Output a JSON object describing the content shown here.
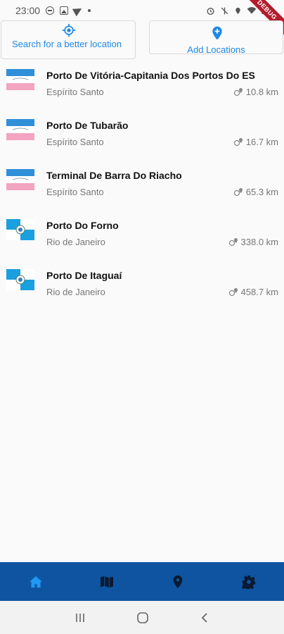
{
  "status_bar": {
    "time": "23:00"
  },
  "debug_banner": "DEBUG",
  "top_buttons": {
    "search_label": "Search for a better location",
    "add_label": "Add Locations"
  },
  "colors": {
    "accent": "#1e88e5",
    "nav_bar": "#0e54a0",
    "nav_active": "#2196f3",
    "nav_inactive": "#0a1a30"
  },
  "locations": [
    {
      "name": "Porto De Vitória-Capitania Dos Portos Do ES",
      "state": "Espírito Santo",
      "distance": "10.8 km",
      "flag": "espirito-santo-flag"
    },
    {
      "name": "Porto De Tubarão",
      "state": "Espírito Santo",
      "distance": "16.7 km",
      "flag": "espirito-santo-flag"
    },
    {
      "name": "Terminal De Barra Do Riacho",
      "state": "Espírito Santo",
      "distance": "65.3 km",
      "flag": "espirito-santo-flag"
    },
    {
      "name": "Porto Do Forno",
      "state": "Rio de Janeiro",
      "distance": "338.0 km",
      "flag": "rio-de-janeiro-flag"
    },
    {
      "name": "Porto De Itaguaí",
      "state": "Rio de Janeiro",
      "distance": "458.7 km",
      "flag": "rio-de-janeiro-flag"
    }
  ],
  "bottom_nav": [
    {
      "icon": "home-icon",
      "active": true
    },
    {
      "icon": "map-icon",
      "active": false
    },
    {
      "icon": "location-pin-icon",
      "active": false
    },
    {
      "icon": "settings-icon",
      "active": false
    }
  ]
}
